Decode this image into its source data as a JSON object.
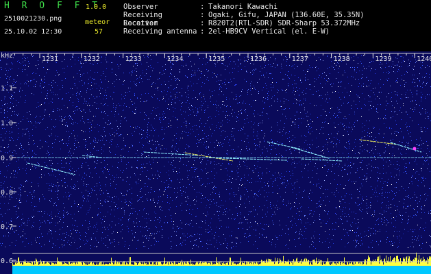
{
  "header": {
    "app_title": "H R O F F T",
    "app_version": "1.0.0",
    "file_name": "2510021230.png",
    "meteor_label": "meteor",
    "date_time": "25.10.02 12:30",
    "meteor_count": "57"
  },
  "info": [
    {
      "key": "Observer",
      "value": "Takanori Kawachi"
    },
    {
      "key": "Receiving Location",
      "value": "Ogaki, Gifu, JAPAN (136.60E, 35.35N)"
    },
    {
      "key": "Receiver",
      "value": "R820T2(RTL-SDR) SDR-Sharp 53.372MHz"
    },
    {
      "key": "Receiving antenna",
      "value": "2el-HB9CV Vertical (el. E-W)"
    }
  ],
  "spectrogram": {
    "y_unit": "kHz",
    "x_ticks": [
      "1231",
      "1232",
      "1233",
      "1234",
      "1235",
      "1236",
      "1237",
      "1238",
      "1239",
      "1240"
    ],
    "y_ticks": [
      "1.1",
      "1.0",
      "0.9",
      "0.8",
      "0.7",
      "0.6"
    ],
    "colors": {
      "background": "#0a0a5a",
      "noise": "#2f45ff",
      "trace": "#8ff0ff",
      "trace_hot": "#ffff60",
      "histogram": "#00c8ff",
      "histogram_peak": "#ffff40",
      "text": "#e8e8e8"
    }
  }
}
